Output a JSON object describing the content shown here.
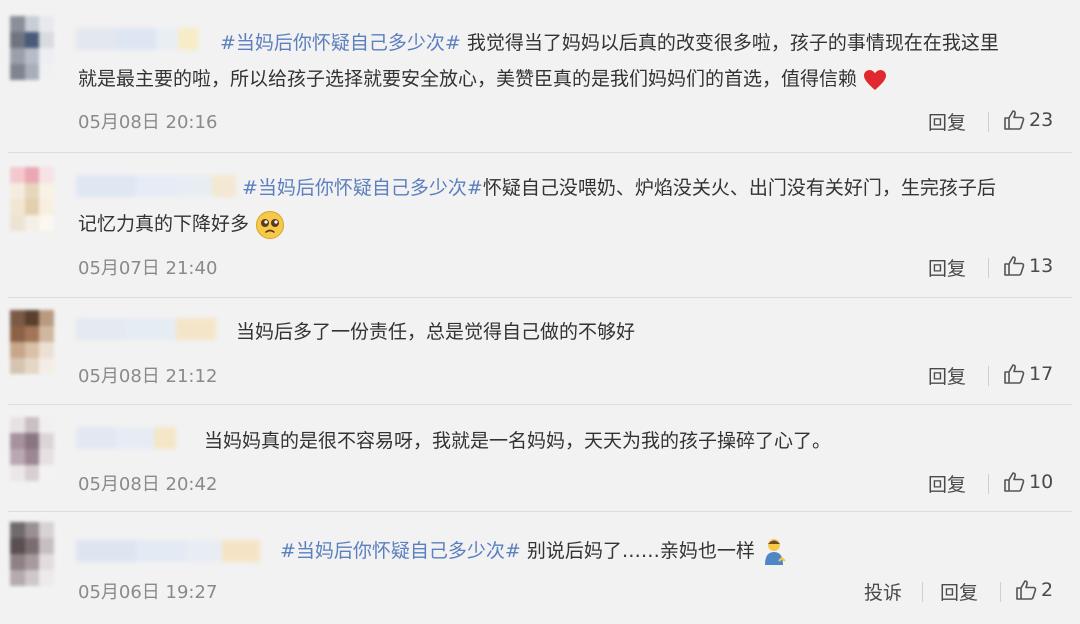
{
  "colors": {
    "hashtag": "#5b7fbf",
    "text": "#333333",
    "meta": "#8a8a8a",
    "heart": "#e0282e"
  },
  "comments": [
    {
      "hashtag": "#当妈后你怀疑自己多少次#",
      "line1": " 我觉得当了妈妈以后真的改变很多啦，孩子的事情现在在我这里",
      "line2": "就是最主要的啦，所以给孩子选择就要安全放心，美赞臣真的是我们妈妈们的首选，值得信赖",
      "emoji": "heart-icon",
      "time": "05月08日 20:16",
      "reply": "回复",
      "likes": "23"
    },
    {
      "hashtag": "#当妈后你怀疑自己多少次#",
      "line1": "怀疑自己没喂奶、炉焰没关火、出门没有关好门，生完孩子后",
      "line2": "记忆力真的下降好多",
      "emoji": "pleading-face-icon",
      "time": "05月07日 21:40",
      "reply": "回复",
      "likes": "13"
    },
    {
      "line1": "当妈后多了一份责任，总是觉得自己做的不够好",
      "time": "05月08日 21:12",
      "reply": "回复",
      "likes": "17"
    },
    {
      "line1": "当妈妈真的是很不容易呀，我就是一名妈妈，天天为我的孩子操碎了心了。",
      "time": "05月08日 20:42",
      "reply": "回复",
      "likes": "10"
    },
    {
      "hashtag": "#当妈后你怀疑自己多少次#",
      "line1": " 别说后妈了……亲妈也一样",
      "emoji": "person-bowing-icon",
      "time": "05月06日 19:27",
      "report": "投诉",
      "reply": "回复",
      "likes": "2"
    }
  ]
}
